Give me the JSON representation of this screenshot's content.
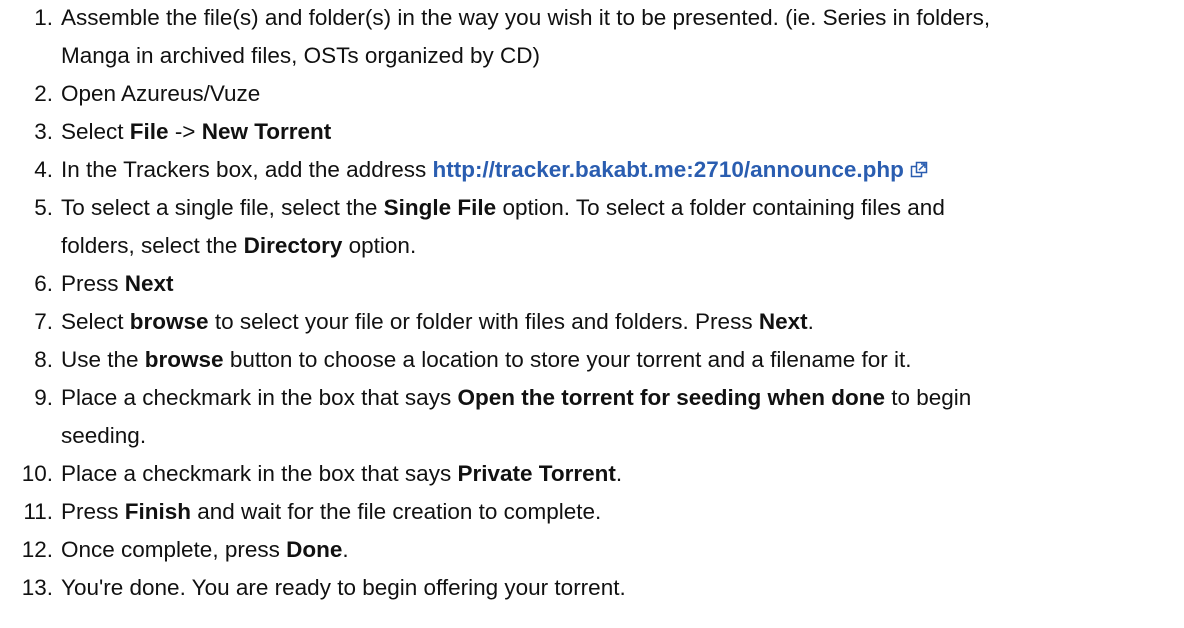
{
  "steps": [
    {
      "number": "1.",
      "line1": "Assemble the file(s) and folder(s) in the way you wish it to be presented. (ie. Series in folders,",
      "line2": "Manga in archived files, OSTs organized by CD)"
    },
    {
      "number": "2.",
      "text": "Open Azureus/Vuze"
    },
    {
      "number": "3.",
      "pre": "Select ",
      "b1": "File",
      "mid": " -> ",
      "b2": "New Torrent"
    },
    {
      "number": "4.",
      "pre": "In the Trackers box, add the address ",
      "link": "http://tracker.bakabt.me:2710/announce.php",
      "link_icon": "external-link-icon"
    },
    {
      "number": "5.",
      "pre": "To select a single file, select the ",
      "b1": "Single File",
      "post": " option. To select a folder containing files and",
      "line2_pre": "folders, select the ",
      "line2_b": "Directory",
      "line2_post": " option."
    },
    {
      "number": "6.",
      "pre": "Press ",
      "b1": "Next"
    },
    {
      "number": "7.",
      "pre": "Select ",
      "b1": "browse",
      "mid": " to select your file or folder with files and folders. Press ",
      "b2": "Next",
      "post": "."
    },
    {
      "number": "8.",
      "pre": "Use the ",
      "b1": "browse",
      "post": " button to choose a location to store your torrent and a filename for it."
    },
    {
      "number": "9.",
      "pre": "Place a checkmark in the box that says ",
      "b1": "Open the torrent for seeding when done",
      "post": " to begin",
      "line2": "seeding."
    },
    {
      "number": "10.",
      "pre": "Place a checkmark in the box that says ",
      "b1": "Private Torrent",
      "post": "."
    },
    {
      "number": "11.",
      "pre": "Press ",
      "b1": "Finish",
      "post": " and wait for the file creation to complete."
    },
    {
      "number": "12.",
      "pre": "Once complete, press ",
      "b1": "Done",
      "post": "."
    },
    {
      "number": "13.",
      "text": "You're done. You are ready to begin offering your torrent."
    }
  ]
}
